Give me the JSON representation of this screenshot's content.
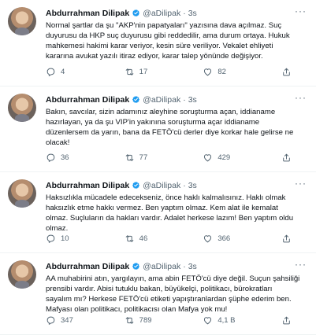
{
  "tweets": [
    {
      "name": "Abdurrahman Dilipak",
      "handle": "@aDilipak",
      "separator": "·",
      "time": "3s",
      "text": "Normal şartlar da şu \"AKP'nin papatyaları\" yazısına dava açılmaz. Suç duyurusu da HKP suç duyurusu gibi reddedilir, ama durum ortaya. Hukuk mahkemesi hakimi karar veriyor, kesin süre veriliyor. Vekalet ehliyeti kararına avukat yazılı itiraz ediyor, karar talep yönünde değişiyor.",
      "replies": "4",
      "retweets": "17",
      "likes": "82"
    },
    {
      "name": "Abdurrahman Dilipak",
      "handle": "@aDilipak",
      "separator": "·",
      "time": "3s",
      "text": "Bakın, savcılar, sizin adamınız aleyhine soruşturma açan, iddianame hazırlayan, ya da şu VIP'in yakınına soruşturma açar iddianame düzenlersem da yarın, bana da FETÖ'cü derler diye korkar hale gelirse ne olacak!",
      "replies": "36",
      "retweets": "77",
      "likes": "429"
    },
    {
      "name": "Abdurrahman Dilipak",
      "handle": "@aDilipak",
      "separator": "·",
      "time": "3s",
      "text": "Haksızlıkla mücadele edecekseniz, önce haklı kalmalısınız. Haklı olmak haksızlık etme hakkı vermez. Ben yaptım olmaz. Kem alat ile kemalat olmaz. Suçluların da hakları vardır. Adalet herkese lazım! Ben yaptım oldu olmaz.",
      "replies": "10",
      "retweets": "46",
      "likes": "366"
    },
    {
      "name": "Abdurrahman Dilipak",
      "handle": "@aDilipak",
      "separator": "·",
      "time": "3s",
      "text": "AA muhabirini atın, yargılayın, ama abin FETÖ'cü diye değil. Suçun şahsiliği prensibi vardır. Abisi tutuklu bakan, büyükelçi, politikacı, bürokratları sayalım mı? Herkese FETÖ'cü etiketi yapıştıranlardan şüphe ederim ben. Mafyası olan politikacı, politikacısı olan Mafya yok mu!",
      "replies": "347",
      "retweets": "789",
      "likes": "4,1 B"
    }
  ],
  "icons": {
    "verified_color": "#1d9bf0",
    "more": "···"
  }
}
